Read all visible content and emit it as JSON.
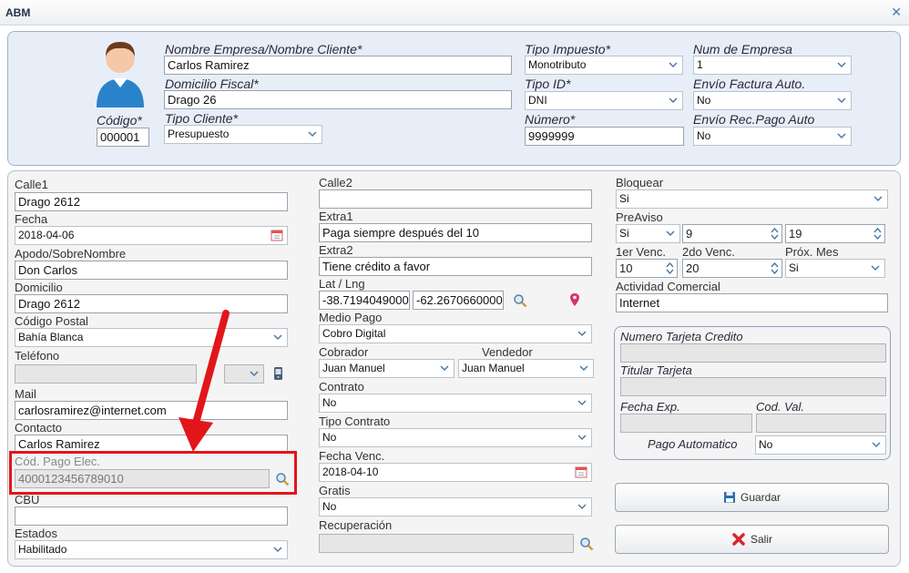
{
  "window": {
    "title": "ABM"
  },
  "top": {
    "codigo_label": "Código*",
    "codigo_value": "000001",
    "nombre_label": "Nombre Empresa/Nombre Cliente*",
    "nombre_value": "Carlos Ramirez",
    "domicilio_fiscal_label": "Domicilio Fiscal*",
    "domicilio_fiscal_value": "Drago 26",
    "tipo_cliente_label": "Tipo Cliente*",
    "tipo_cliente_value": "Presupuesto",
    "tipo_impuesto_label": "Tipo Impuesto*",
    "tipo_impuesto_value": "Monotributo",
    "tipo_id_label": "Tipo ID*",
    "tipo_id_value": "DNI",
    "numero_label": "Número*",
    "numero_value": "9999999",
    "num_empresa_label": "Num de Empresa",
    "num_empresa_value": "1",
    "envio_factura_label": "Envío Factura Auto.",
    "envio_factura_value": "No",
    "envio_recpago_label": "Envío Rec.Pago Auto",
    "envio_recpago_value": "No"
  },
  "col1": {
    "calle1_label": "Calle1",
    "calle1_value": "Drago 2612",
    "fecha_label": "Fecha",
    "fecha_value": "2018-04-06",
    "apodo_label": "Apodo/SobreNombre",
    "apodo_value": "Don Carlos",
    "domicilio_label": "Domicilio",
    "domicilio_value": "Drago 2612",
    "cp_label": "Código Postal",
    "cp_value": "Bahía Blanca",
    "telefono_label": "Teléfono",
    "mail_label": "Mail",
    "mail_value": "carlosramirez@internet.com",
    "contacto_label": "Contacto",
    "contacto_value": "Carlos Ramirez",
    "cod_pago_label": "Cód. Pago Elec.",
    "cod_pago_value": "4000123456789010",
    "cbu_label": "CBU",
    "estados_label": "Estados",
    "estados_value": "Habilitado"
  },
  "col2": {
    "calle2_label": "Calle2",
    "extra1_label": "Extra1",
    "extra1_value": "Paga siempre después del 10",
    "extra2_label": "Extra2",
    "extra2_value": "Tiene crédito a favor",
    "latlng_label": "Lat / Lng",
    "lat_value": "-38.7194049000",
    "lng_value": "-62.2670660000",
    "medio_pago_label": "Medio Pago",
    "medio_pago_value": "Cobro Digital",
    "cobrador_label": "Cobrador",
    "cobrador_value": "Juan Manuel",
    "vendedor_label": "Vendedor",
    "vendedor_value": "Juan Manuel",
    "contrato_label": "Contrato",
    "contrato_value": "No",
    "tipo_contrato_label": "Tipo Contrato",
    "tipo_contrato_value": "No",
    "fecha_venc_label": "Fecha Venc.",
    "fecha_venc_value": "2018-04-10",
    "gratis_label": "Gratis",
    "gratis_value": "No",
    "recuperacion_label": "Recuperación"
  },
  "col3": {
    "bloquear_label": "Bloquear",
    "bloquear_value": "Si",
    "preaviso_label": "PreAviso",
    "preaviso_value": "Si",
    "preaviso_n1": "9",
    "preaviso_n2": "19",
    "venc1_label": "1er Venc.",
    "venc1_value": "10",
    "venc2_label": "2do Venc.",
    "venc2_value": "20",
    "prox_mes_label": "Próx. Mes",
    "prox_mes_value": "Si",
    "actividad_label": "Actividad Comercial",
    "actividad_value": "Internet",
    "tarjeta_label": "Numero Tarjeta Credito",
    "titular_label": "Titular Tarjeta",
    "fecha_exp_label": "Fecha Exp.",
    "cod_val_label": "Cod. Val.",
    "pago_auto_label": "Pago Automatico",
    "pago_auto_value": "No",
    "guardar_label": "Guardar",
    "salir_label": "Salir"
  },
  "colors": {
    "highlight": "#e2161a",
    "panel_top": "#e8eef8",
    "accent": "#4a79a8"
  }
}
